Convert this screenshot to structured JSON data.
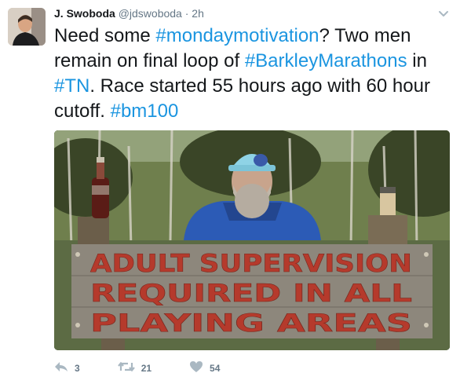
{
  "author": {
    "name": "J. Swoboda",
    "handle": "@jdswoboda",
    "separator": "·",
    "time": "2h"
  },
  "tweet": {
    "segments": [
      {
        "text": "Need some ",
        "hashtag": false
      },
      {
        "text": "#mondaymotivation",
        "hashtag": true
      },
      {
        "text": "? Two men remain on final loop of ",
        "hashtag": false
      },
      {
        "text": "#BarkleyMarathons",
        "hashtag": true
      },
      {
        "text": " in ",
        "hashtag": false
      },
      {
        "text": "#TN",
        "hashtag": true
      },
      {
        "text": ". Race started 55 hours ago with 60 hour cutoff. ",
        "hashtag": false
      },
      {
        "text": "#bm100",
        "hashtag": true
      }
    ]
  },
  "media": {
    "sign_lines": [
      "ADULT SUPERVISION",
      "REQUIRED   IN   ALL",
      "PLAYING         AREAS"
    ]
  },
  "actions": {
    "reply_count": "3",
    "retweet_count": "21",
    "like_count": "54"
  },
  "colors": {
    "hashtag": "#1b95e0",
    "meta": "#657786",
    "action_icon": "#aab8c2",
    "sign_text": "#b53a2c"
  },
  "icons": {
    "menu": "chevron-down-icon",
    "reply": "reply-icon",
    "retweet": "retweet-icon",
    "like": "heart-icon"
  }
}
